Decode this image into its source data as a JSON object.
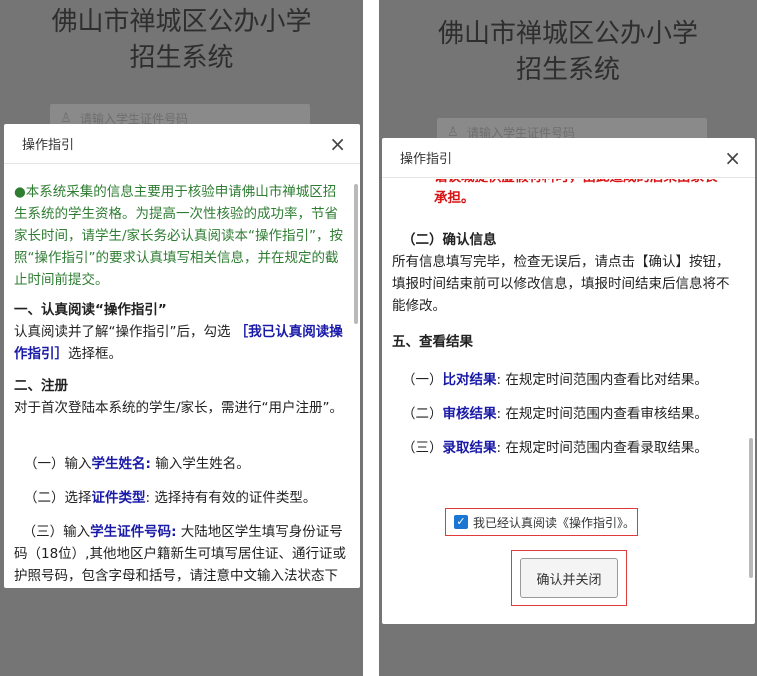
{
  "app": {
    "title_line1": "佛山市禅城区公办小学",
    "title_line2": "招生系统"
  },
  "search": {
    "placeholder": "请输入学生证件号码"
  },
  "modal": {
    "title": "操作指引",
    "close_glyph": "×"
  },
  "left": {
    "intro": "●本系统采集的信息主要用于核验申请佛山市禅城区招生系统的学生资格。为提高一次性核验的成功率，节省家长时间，请学生/家长务必认真阅读本“操作指引”，按照“操作指引”的要求认真填写相关信息，并在规定的截止时间前提交。",
    "s1_title": "一、认真阅读“操作指引”",
    "s1_pre": " 认真阅读并了解“操作指引”后，勾选 ",
    "s1_link": "［我已认真阅读操作指引］",
    "s1_post": "选择框。",
    "s2_title": "二、注册",
    "s2_body": " 对于首次登陆本系统的学生/家长，需进行“用户注册”。",
    "i1_pre": "（一）输入",
    "i1_key": "学生姓名:",
    "i1_post": " 输入学生姓名。",
    "i2_pre": "（二）选择",
    "i2_key": "证件类型",
    "i2_post": ": 选择持有有效的证件类型。",
    "i3_pre": "（三）输入",
    "i3_key": "学生证件号码:",
    "i3_post": " 大陆地区学生填写身份证号码（18位）,其他地区户籍新生可填写居住证、通行证或护照号码，包含字母和括号，请注意中文输入法状态下不要设置为半角输入，字母统一为大写。"
  },
  "right": {
    "red_cut": "谐谈城提供虚假材料时，由此造成的后果由家长",
    "red_tail": "承担。",
    "s2_title": "（二）确认信息",
    "s2_body": " 所有信息填写完毕，检查无误后，请点击【确认】按钮，填报时间结束前可以修改信息，填报时间结束后信息将不能修改。",
    "s5_title": "五、查看结果",
    "r1_pre": "（一）",
    "r1_key": "比对结果",
    "r1_post": ": 在规定时间范围内查看比对结果。",
    "r2_pre": "（二）",
    "r2_key": "审核结果",
    "r2_post": ": 在规定时间范围内查看审核结果。",
    "r3_pre": "（三）",
    "r3_key": "录取结果",
    "r3_post": ": 在规定时间范围内查看录取结果。",
    "checkbox_label": "我已经认真阅读《操作指引》。",
    "confirm_button": "确认并关闭"
  }
}
